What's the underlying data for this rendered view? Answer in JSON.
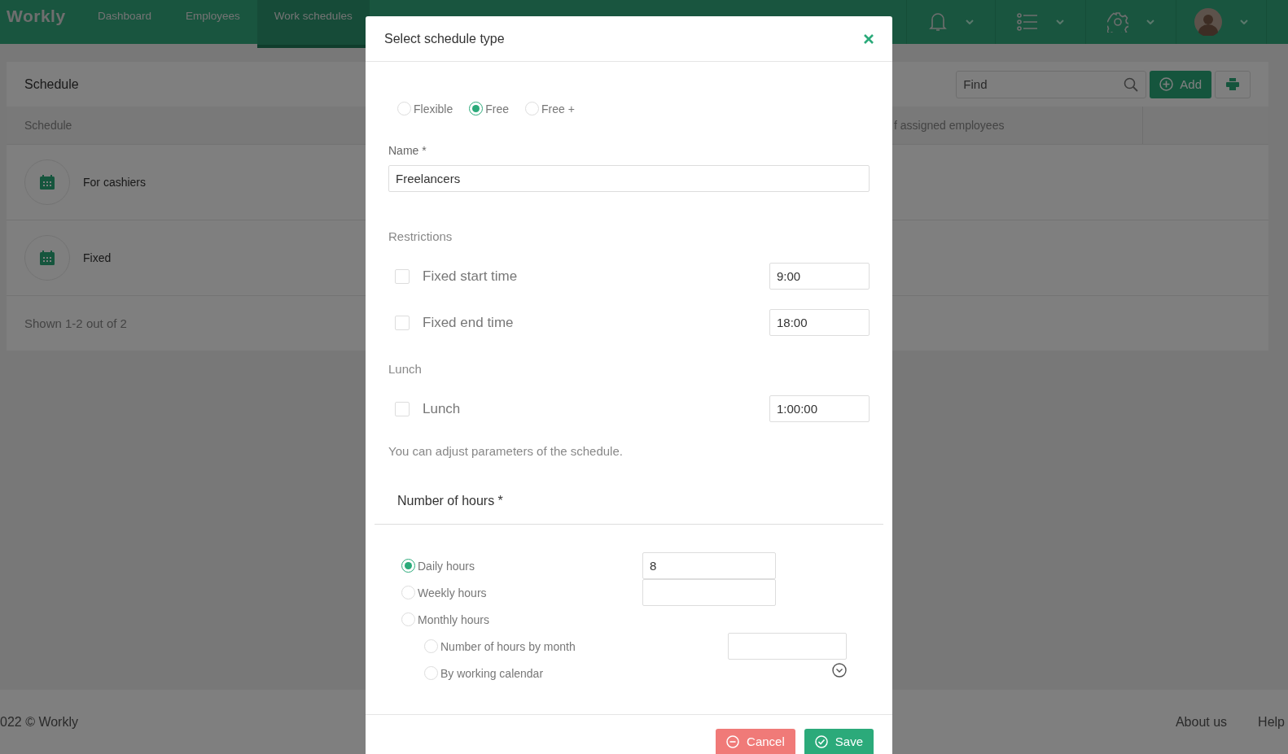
{
  "navbar": {
    "logo": "Workly",
    "items": [
      {
        "label": "Dashboard",
        "selected": false
      },
      {
        "label": "Employees",
        "selected": false
      },
      {
        "label": "Work schedules",
        "selected": true
      }
    ]
  },
  "toolbar": {
    "title": "Schedule",
    "search": {
      "placeholder": "Find"
    },
    "add_button": "Add"
  },
  "table": {
    "columns": [
      "Schedule",
      "f assigned employees"
    ],
    "rows": [
      {
        "name": "For cashiers"
      },
      {
        "name": "Fixed"
      }
    ],
    "footer": "Shown 1-2 out of 2"
  },
  "footer": {
    "copyright": "022 © Workly",
    "links": [
      "About us",
      "Help"
    ]
  },
  "dialog": {
    "title": "Select schedule type",
    "types": [
      {
        "label": "Flexible",
        "selected": false
      },
      {
        "label": "Free",
        "selected": true
      },
      {
        "label": "Free +",
        "selected": false
      }
    ],
    "name": {
      "label": "Name *",
      "value": "Freelancers"
    },
    "restrictions": {
      "title": "Restrictions",
      "items": [
        {
          "label": "Fixed start time",
          "checked": false,
          "value": "9:00"
        },
        {
          "label": "Fixed end time",
          "checked": false,
          "value": "18:00"
        }
      ]
    },
    "lunch": {
      "title": "Lunch",
      "items": [
        {
          "label": "Lunch",
          "checked": false,
          "value": "1:00:00"
        }
      ]
    },
    "hint": "You can adjust parameters of the schedule.",
    "hours": {
      "title": "Number of hours *",
      "options": [
        {
          "label": "Daily hours",
          "selected": true,
          "kind": "input",
          "value": "8"
        },
        {
          "label": "Weekly hours",
          "selected": false,
          "kind": "input"
        },
        {
          "label": "Monthly hours",
          "selected": false,
          "kind": "none",
          "children": [
            {
              "label": "Number of hours by month",
              "selected": false,
              "kind": "input"
            },
            {
              "label": "By working calendar",
              "selected": false,
              "kind": "dropdown"
            }
          ]
        }
      ]
    },
    "buttons": [
      {
        "label": "Cancel",
        "kind": "cancel"
      },
      {
        "label": "Save",
        "kind": "save"
      }
    ]
  }
}
